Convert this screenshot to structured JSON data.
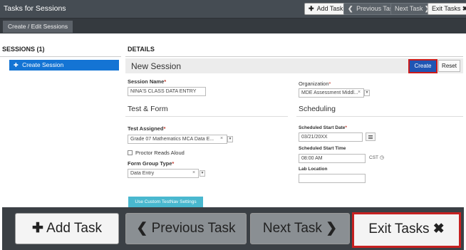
{
  "header": {
    "title": "Tasks for Sessions",
    "add_task": "Add Task",
    "previous_task": "Previous Task",
    "next_task": "Next Task",
    "exit_tasks": "Exit Tasks"
  },
  "subtab": {
    "label": "Create / Edit Sessions"
  },
  "sessions": {
    "heading": "SESSIONS (1)",
    "items": [
      {
        "label": "Create Session"
      }
    ]
  },
  "details": {
    "heading": "DETAILS",
    "title": "New Session",
    "create": "Create",
    "reset": "Reset",
    "session_name": {
      "label": "Session Name",
      "value": "NINA'S CLASS DATA ENTRY"
    },
    "organization": {
      "label": "Organization",
      "value": "MDE Assessment Middl..."
    },
    "test_form": {
      "title": "Test & Form",
      "test_assigned": {
        "label": "Test Assigned",
        "value": "Grade 07 Mathematics MCA Data E..."
      },
      "proctor_reads": "Proctor Reads Aloud",
      "form_group": {
        "label": "Form Group Type",
        "value": "Data Entry"
      },
      "testnav_button": "Use Custom TestNav Settings"
    },
    "scheduling": {
      "title": "Scheduling",
      "start_date": {
        "label": "Scheduled Start Date",
        "value": "03/21/20XX"
      },
      "start_time": {
        "label": "Scheduled Start Time",
        "value": "08:00 AM",
        "timezone": "CST"
      },
      "lab_location": {
        "label": "Lab Location",
        "value": ""
      }
    }
  },
  "zoom": {
    "add_task": "Add Task",
    "previous_task": "Previous Task",
    "next_task": "Next Task",
    "exit_tasks": "Exit Tasks"
  },
  "icons": {
    "plus": "plus-circle-icon",
    "chevron_left": "chevron-left-icon",
    "chevron_right": "chevron-right-icon",
    "close": "close-icon",
    "calendar": "calendar-icon",
    "clock": "clock-icon"
  },
  "colors": {
    "header_bg": "#454c53",
    "accent_blue": "#1474d4",
    "create_blue": "#1f55b4",
    "highlight_red": "#cc1a1a",
    "testnav_teal": "#49b8cf"
  }
}
